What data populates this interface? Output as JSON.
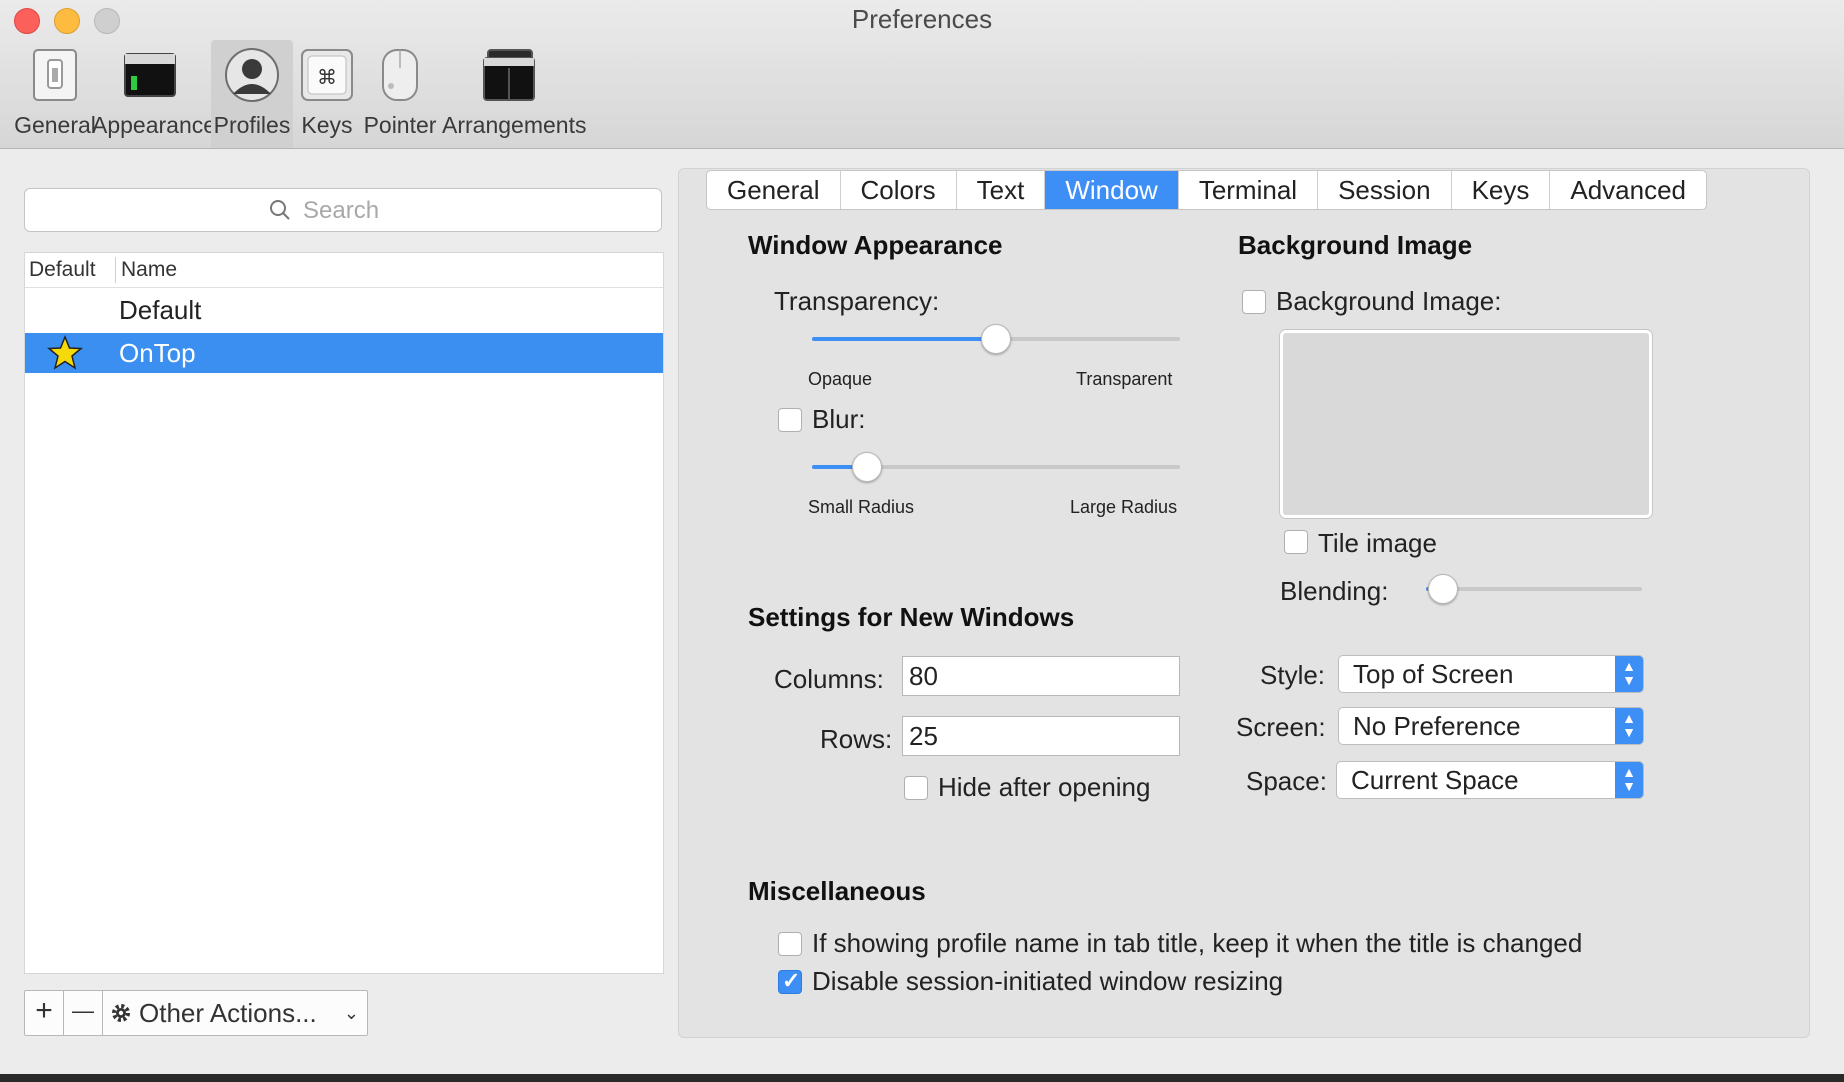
{
  "window": {
    "title": "Preferences"
  },
  "toolbar": {
    "items": [
      {
        "label": "General",
        "icon": "switch-icon"
      },
      {
        "label": "Appearance",
        "icon": "appearance-icon"
      },
      {
        "label": "Profiles",
        "icon": "profile-icon"
      },
      {
        "label": "Keys",
        "icon": "command-key-icon"
      },
      {
        "label": "Pointer",
        "icon": "mouse-icon"
      },
      {
        "label": "Arrangements",
        "icon": "arrangements-icon"
      }
    ],
    "active": "Profiles"
  },
  "profiles": {
    "search_placeholder": "Search",
    "columns": [
      "Default",
      "Name"
    ],
    "rows": [
      {
        "name": "Default",
        "is_default": false,
        "selected": false
      },
      {
        "name": "OnTop",
        "is_default": true,
        "selected": true
      }
    ],
    "add_label": "+",
    "remove_label": "—",
    "other_actions_label": "Other Actions..."
  },
  "tabs": {
    "items": [
      "General",
      "Colors",
      "Text",
      "Window",
      "Terminal",
      "Session",
      "Keys",
      "Advanced"
    ],
    "active": "Window"
  },
  "window_appearance": {
    "heading": "Window Appearance",
    "transparency_label": "Transparency:",
    "transparency_value": 0.5,
    "opaque_label": "Opaque",
    "transparent_label": "Transparent",
    "blur_label": "Blur:",
    "blur_checked": false,
    "blur_value": 0.15,
    "small_radius_label": "Small Radius",
    "large_radius_label": "Large Radius"
  },
  "background_image": {
    "heading": "Background Image",
    "checkbox_label": "Background Image:",
    "checked": false,
    "tile_label": "Tile image",
    "tile_checked": false,
    "blending_label": "Blending:",
    "blending_value": 0.08
  },
  "new_windows": {
    "heading": "Settings for New Windows",
    "columns_label": "Columns:",
    "columns_value": "80",
    "rows_label": "Rows:",
    "rows_value": "25",
    "hide_label": "Hide after opening",
    "hide_checked": false,
    "style_label": "Style:",
    "style_value": "Top of Screen",
    "screen_label": "Screen:",
    "screen_value": "No Preference",
    "space_label": "Space:",
    "space_value": "Current Space"
  },
  "misc": {
    "heading": "Miscellaneous",
    "option1_label": "If showing profile name in tab title, keep it when the title is changed",
    "option1_checked": false,
    "option2_label": "Disable session-initiated window resizing",
    "option2_checked": true
  },
  "colors": {
    "accent": "#3d8ef5",
    "selection": "#3b8ff0",
    "star": "#f5d90a"
  }
}
